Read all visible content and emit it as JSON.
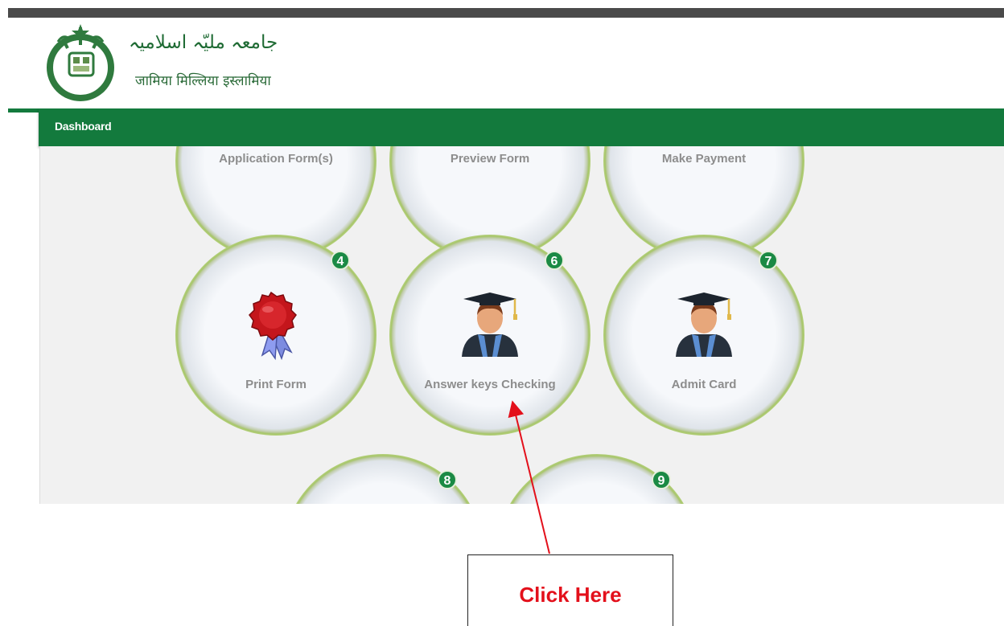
{
  "header": {
    "urdu_title": "جامعہ ملیّہ اسلامیہ",
    "hindi_title": "जामिया मिल्लिया इस्लामिया"
  },
  "nav": {
    "dashboard": "Dashboard"
  },
  "tiles": [
    {
      "label": "Application Form(s)"
    },
    {
      "label": "Preview Form"
    },
    {
      "label": "Make Payment"
    },
    {
      "label": "Print Form",
      "badge": "4",
      "icon": "wax-seal-icon"
    },
    {
      "label": "Answer keys Checking",
      "badge": "6",
      "icon": "graduate-icon"
    },
    {
      "label": "Admit Card",
      "badge": "7",
      "icon": "graduate-icon"
    },
    {
      "label": "",
      "badge": "8"
    },
    {
      "label": "",
      "badge": "9"
    }
  ],
  "callout": {
    "text": "Click Here"
  },
  "colors": {
    "brand_green": "#137a3d",
    "badge_green": "#1b8a44",
    "callout_red": "#e3101b",
    "tile_ring": "#a7c66a"
  }
}
